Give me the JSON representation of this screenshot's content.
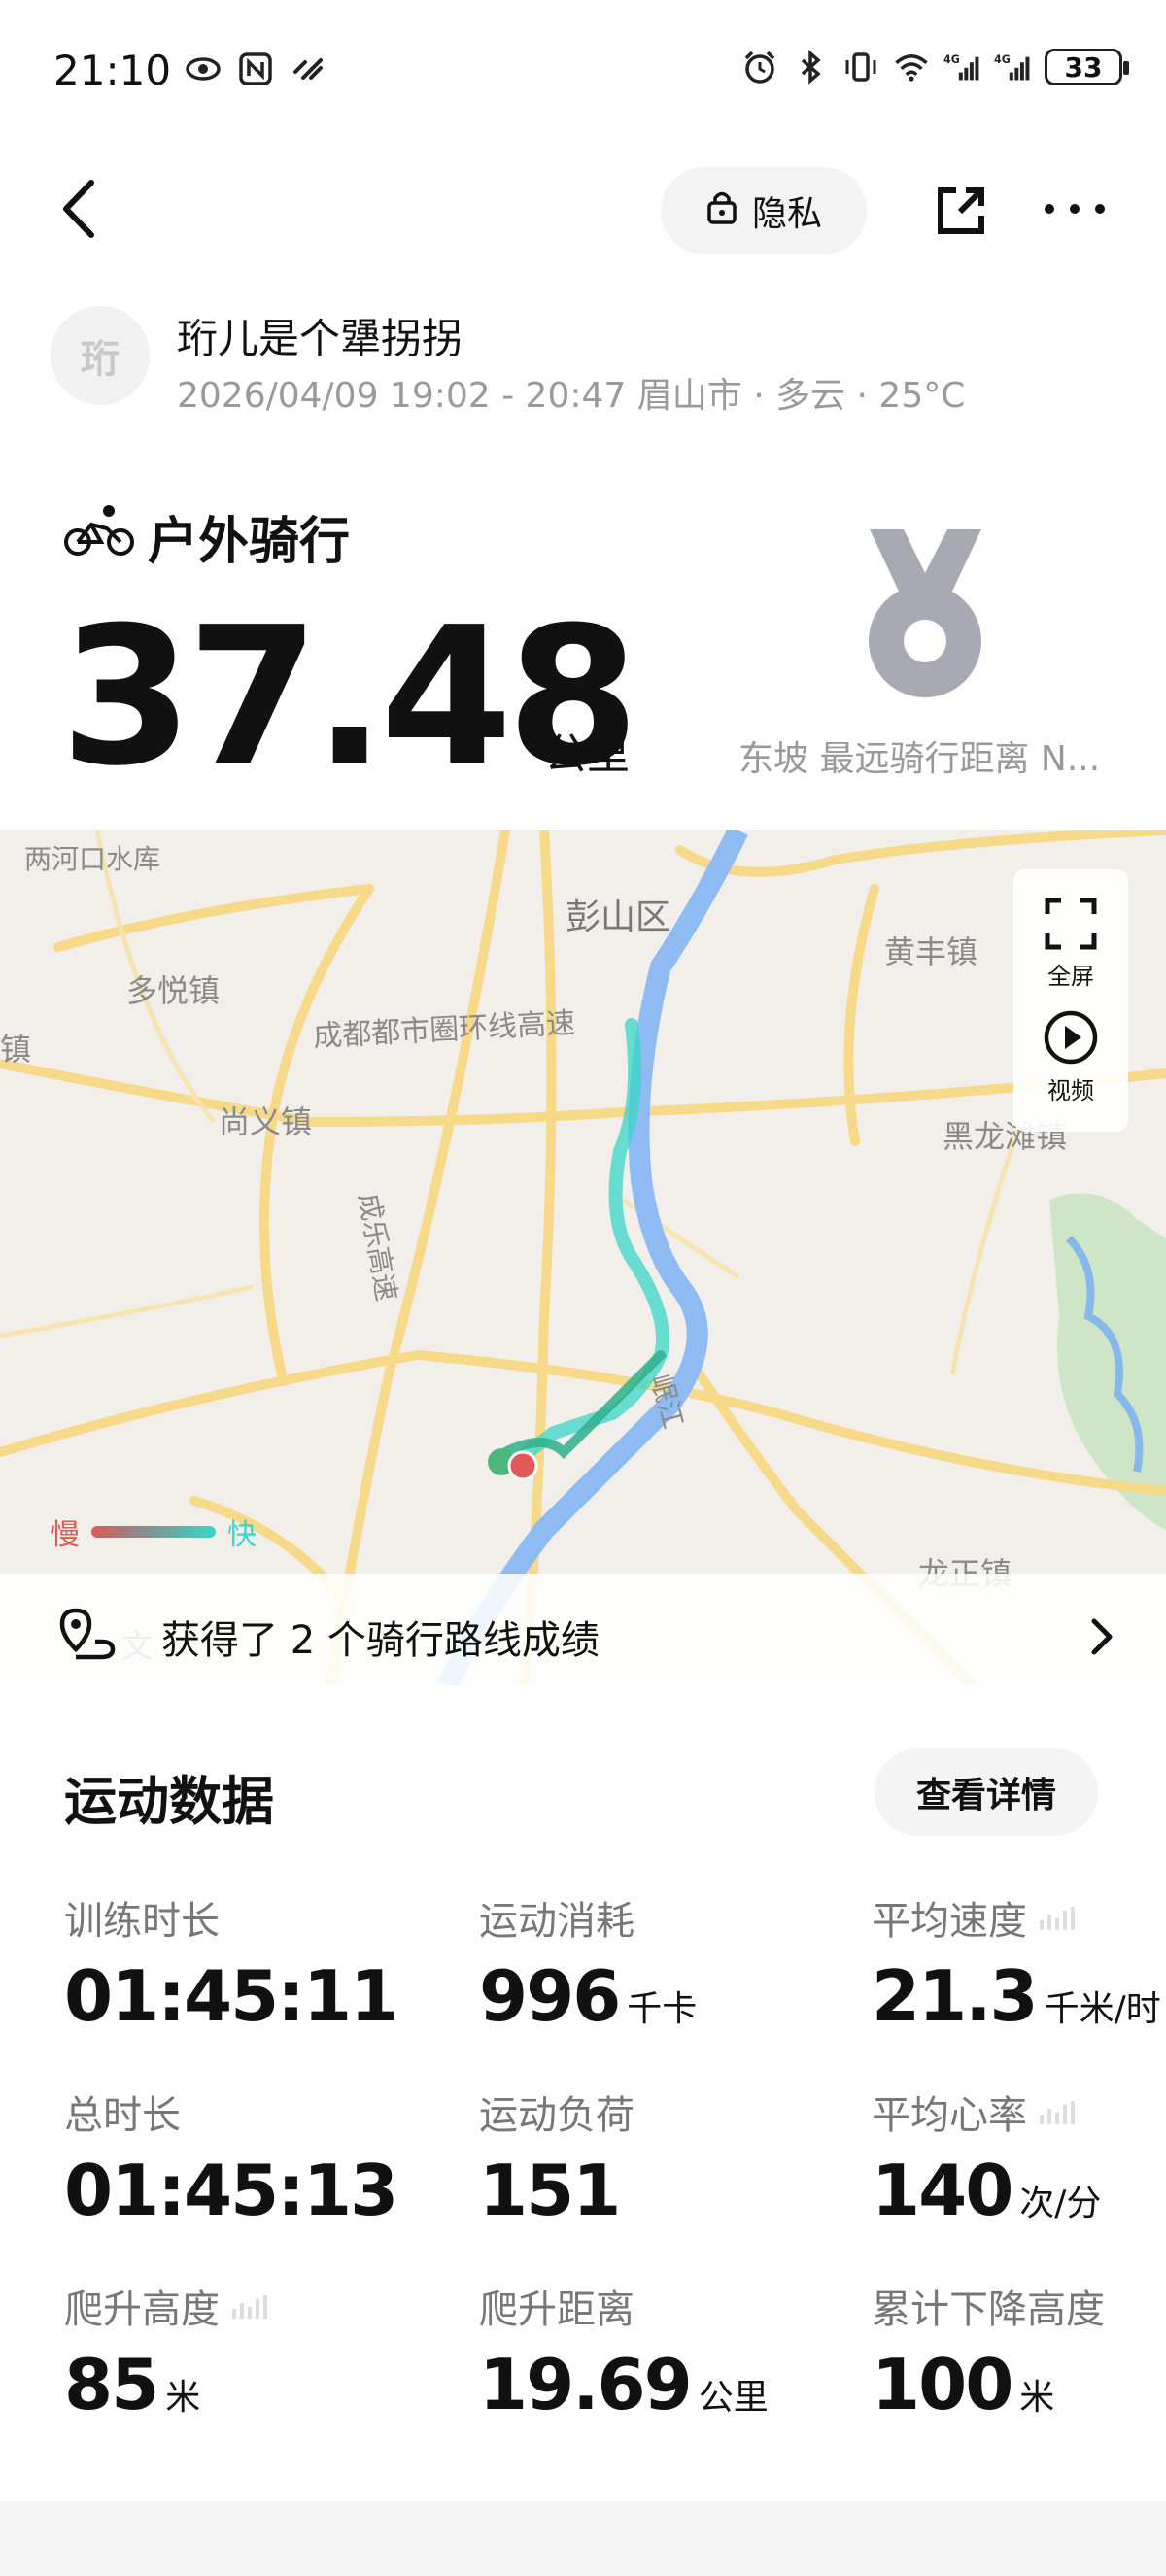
{
  "status_bar": {
    "time": "21:10",
    "left_icons": [
      "eye-icon",
      "nfc-icon",
      "link-icon"
    ],
    "right_icons": [
      "alarm-icon",
      "bluetooth-icon",
      "vibrate-icon",
      "wifi-icon",
      "signal-4g-icon",
      "signal-4g-icon"
    ],
    "battery": "33"
  },
  "nav": {
    "privacy_label": "隐私"
  },
  "user": {
    "avatar_text": "珩",
    "name": "珩儿是个犟拐拐",
    "meta": "2026/04/09 19:02 - 20:47 眉山市 · 多云 · 25°C"
  },
  "activity": {
    "title": "户外骑行",
    "distance": "37.48",
    "distance_unit": "公里",
    "medal_caption": "东坡 最远骑行距离 N..."
  },
  "map": {
    "labels": [
      "两河口水库",
      "彭山区",
      "黄丰镇",
      "多悦镇",
      "成都都市圈环线高速",
      "镇",
      "尚义镇",
      "成乐高速",
      "黑龙滩镇",
      "岷江",
      "龙正镇",
      "文"
    ],
    "fullscreen_label": "全屏",
    "video_label": "视频",
    "legend_slow": "慢",
    "legend_fast": "快",
    "colors": {
      "route_fast": "#39d6c8",
      "route_slow": "#e05a55",
      "river": "#7fb2f0",
      "road": "#f7d98a"
    }
  },
  "achievement": {
    "text": "获得了 2 个骑行路线成绩"
  },
  "stats": {
    "title": "运动数据",
    "details_label": "查看详情",
    "items": [
      {
        "label": "训练时长",
        "value": "01:45:11",
        "unit": ""
      },
      {
        "label": "运动消耗",
        "value": "996",
        "unit": "千卡"
      },
      {
        "label": "平均速度",
        "value": "21.3",
        "unit": "千米/时"
      },
      {
        "label": "总时长",
        "value": "01:45:13",
        "unit": ""
      },
      {
        "label": "运动负荷",
        "value": "151",
        "unit": ""
      },
      {
        "label": "平均心率",
        "value": "140",
        "unit": "次/分"
      },
      {
        "label": "爬升高度",
        "value": "85",
        "unit": "米"
      },
      {
        "label": "爬升距离",
        "value": "19.69",
        "unit": "公里"
      },
      {
        "label": "累计下降高度",
        "value": "100",
        "unit": "米"
      }
    ]
  }
}
